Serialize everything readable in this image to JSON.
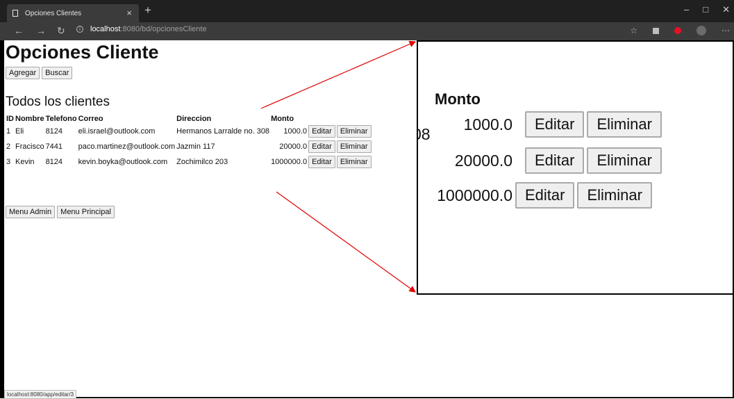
{
  "browser": {
    "tab_title": "Opciones Clientes",
    "tab_close": "×",
    "new_tab": "+",
    "url_host": "localhost",
    "url_path": ":8080/bd/opcionesCliente"
  },
  "page": {
    "title": "Opciones Cliente",
    "subtitle": "Todos los clientes",
    "add_label": "Agregar",
    "search_label": "Buscar",
    "admin_menu_label": "Menu Admin",
    "main_menu_label": "Menu Principal"
  },
  "table": {
    "headers": [
      "ID",
      "Nombre",
      "Telefono",
      "Correo",
      "Direccion",
      "Monto"
    ],
    "edit_label": "Editar",
    "delete_label": "Eliminar",
    "rows": [
      {
        "id": "1",
        "name": "Eli",
        "phone": "8124",
        "email": "eli.israel@outlook.com",
        "address": "Hermanos Larralde no. 308",
        "amount": "1000.0"
      },
      {
        "id": "2",
        "name": "Fracisco",
        "phone": "7441",
        "email": "paco.martinez@outlook.com",
        "address": "Jazmin 117",
        "amount": "20000.0"
      },
      {
        "id": "3",
        "name": "Kevin",
        "phone": "8124",
        "email": "kevin.boyka@outlook.com",
        "address": "Zochimilco 203",
        "amount": "1000000.0"
      }
    ]
  },
  "zoom": {
    "header": "Monto",
    "clipped_text": "08",
    "values": [
      "1000.0",
      "20000.0",
      "1000000.0"
    ],
    "edit_label": "Editar",
    "delete_label": "Eliminar"
  },
  "status_bar": {
    "link": "localhost:8080/app/editar/3"
  },
  "colors": {
    "annotation_arrow": "#e00000",
    "chrome_dark": "#202020"
  }
}
